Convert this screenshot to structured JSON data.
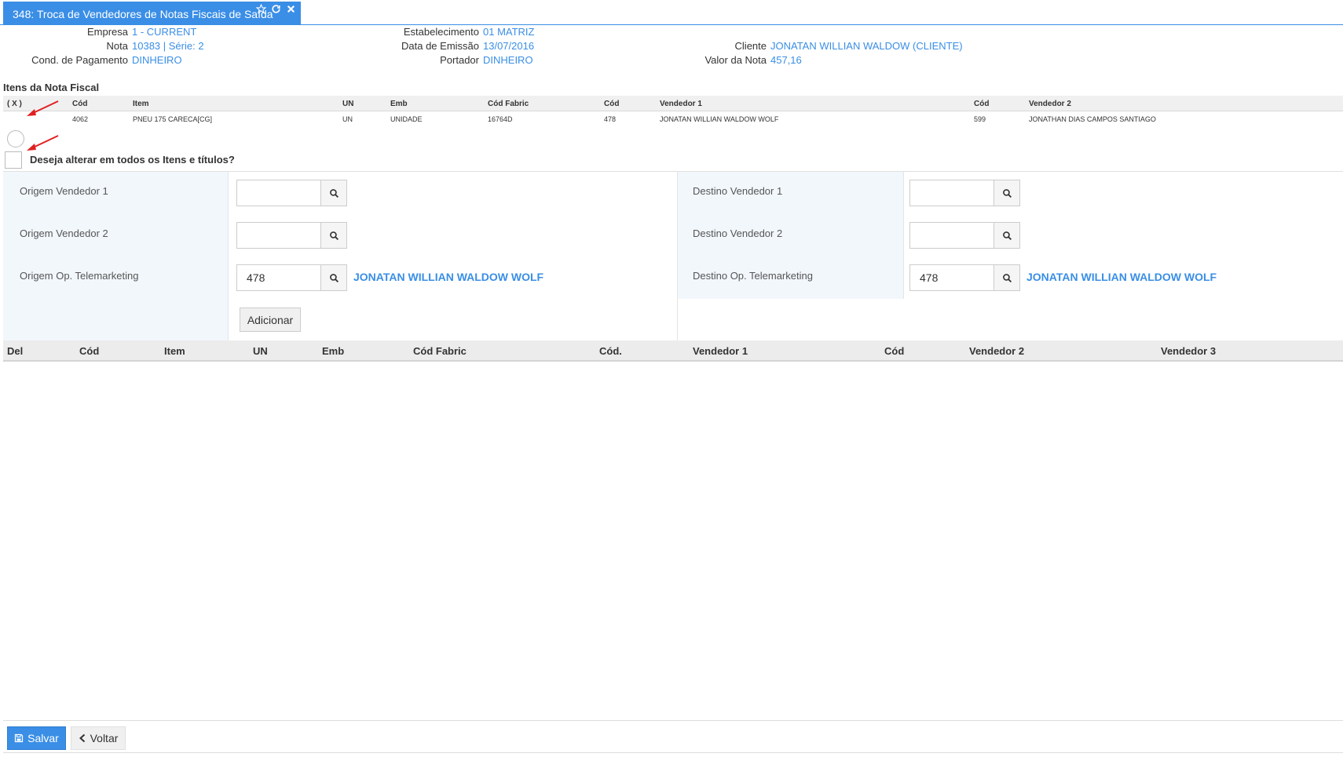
{
  "tab": {
    "title": "348: Troca de Vendedores de Notas Fiscais de Saída",
    "icons": [
      "star-icon",
      "refresh-icon",
      "close-icon"
    ]
  },
  "header": {
    "empresa_label": "Empresa",
    "empresa_value": "1 - CURRENT",
    "nota_label": "Nota",
    "nota_value": "10383 | Série: 2",
    "cond_label": "Cond. de Pagamento",
    "cond_value": "DINHEIRO",
    "estab_label": "Estabelecimento",
    "estab_value": "01 MATRIZ",
    "data_label": "Data de Emissão",
    "data_value": "13/07/2016",
    "portador_label": "Portador",
    "portador_value": "DINHEIRO",
    "cliente_label": "Cliente",
    "cliente_value": "JONATAN WILLIAN WALDOW (CLIENTE)",
    "valor_label": "Valor da Nota",
    "valor_value": "457,16"
  },
  "items_section": {
    "title": "Itens da Nota Fiscal",
    "columns": [
      "( X )",
      "Cód",
      "Item",
      "UN",
      "Emb",
      "Cód Fabric",
      "Cód",
      "Vendedor 1",
      "Cód",
      "Vendedor 2"
    ],
    "rows": [
      [
        "",
        "4062",
        "PNEU 175 CARECA[CG]",
        "UN",
        "UNIDADE",
        "16764D",
        "478",
        "JONATAN WILLIAN WALDOW WOLF",
        "599",
        "JONATHAN DIAS CAMPOS SANTIAGO"
      ]
    ]
  },
  "change_all": {
    "label": "Deseja alterar em todos os Itens e títulos?"
  },
  "form": {
    "origem_v1_label": "Origem Vendedor 1",
    "origem_v2_label": "Origem Vendedor 2",
    "origem_tele_label": "Origem Op. Telemarketing",
    "destino_v1_label": "Destino Vendedor 1",
    "destino_v2_label": "Destino Vendedor 2",
    "destino_tele_label": "Destino Op. Telemarketing",
    "origem_v1_value": "",
    "origem_v2_value": "",
    "origem_tele_value": "478",
    "origem_tele_name": "JONATAN WILLIAN WALDOW WOLF",
    "destino_v1_value": "",
    "destino_v2_value": "",
    "destino_tele_value": "478",
    "destino_tele_name": "JONATAN WILLIAN WALDOW WOLF",
    "add_button": "Adicionar"
  },
  "results": {
    "columns": [
      "Del",
      "Cód",
      "Item",
      "UN",
      "Emb",
      "Cód Fabric",
      "Cód.",
      "Vendedor 1",
      "Cód",
      "Vendedor 2",
      "Vendedor 3"
    ]
  },
  "footer": {
    "save_label": "Salvar",
    "back_label": "Voltar"
  },
  "colors": {
    "accent": "#3a8ee6",
    "arrow": "#e02020"
  }
}
